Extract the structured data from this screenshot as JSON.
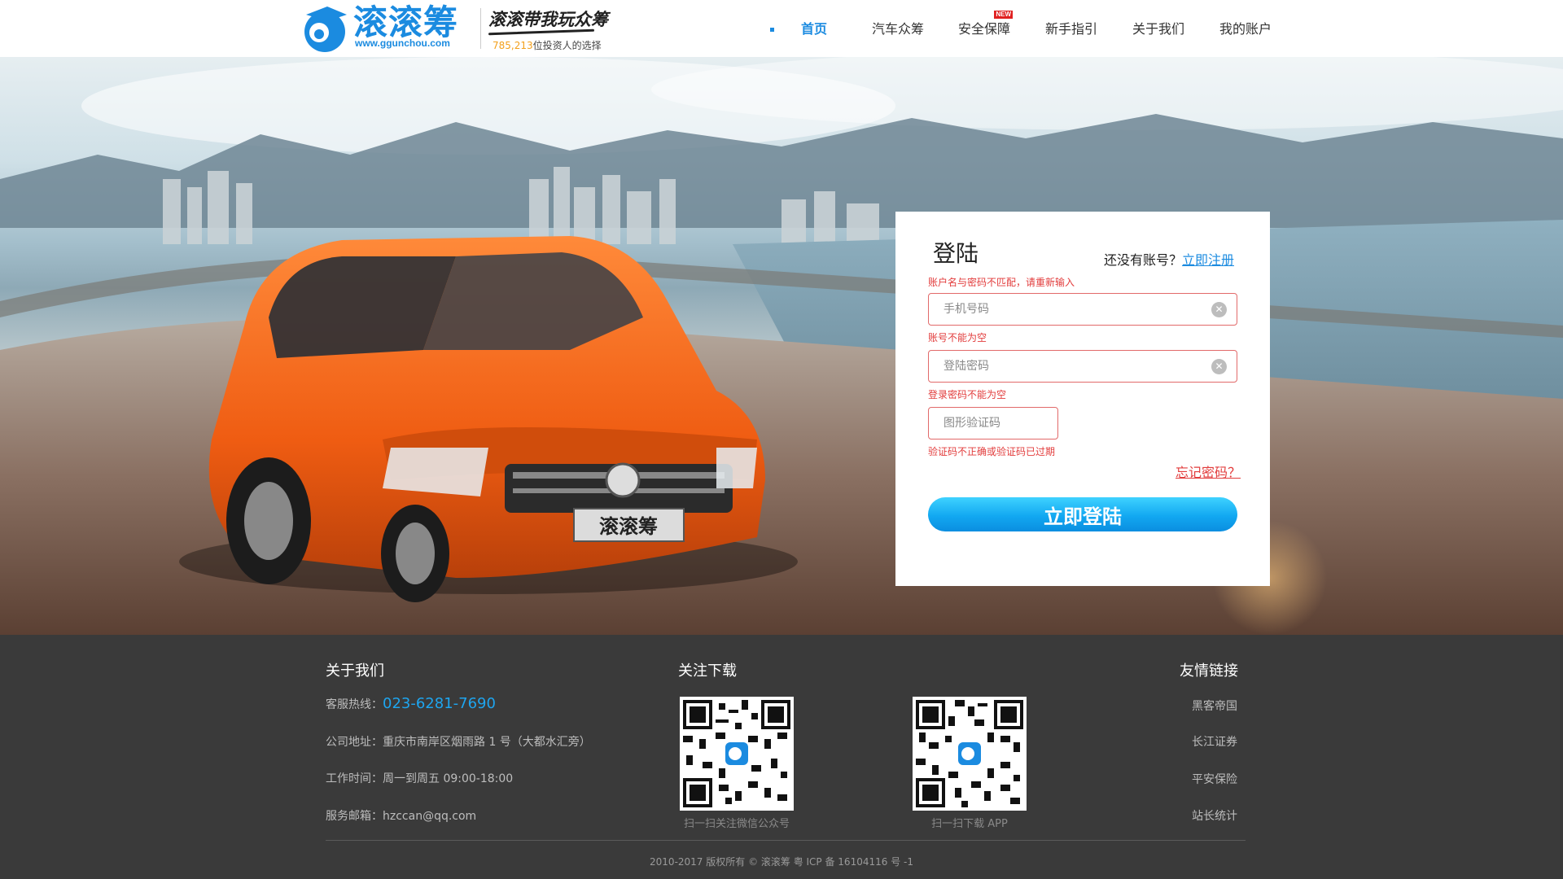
{
  "header": {
    "logo_text": "滚滚筹",
    "logo_url": "www.ggunchou.com",
    "slogan": "滚滚带我玩众筹",
    "tagline_count": "785,213",
    "tagline_rest": "位投资人的选择"
  },
  "nav": {
    "items": [
      {
        "label": "首页",
        "active": true
      },
      {
        "label": "汽车众筹"
      },
      {
        "label": "安全保障",
        "badge": "NEW"
      },
      {
        "label": "新手指引"
      },
      {
        "label": "关于我们"
      },
      {
        "label": "我的账户"
      }
    ]
  },
  "hero": {
    "plate_text": "滚滚筹"
  },
  "login": {
    "title": "登陆",
    "register_prompt": "还没有账号？",
    "register_link": "立即注册",
    "top_error": "账户名与密码不匹配，请重新输入",
    "phone_placeholder": "手机号码",
    "phone_error": "账号不能为空",
    "password_placeholder": "登陆密码",
    "password_error": "登录密码不能为空",
    "captcha_placeholder": "图形验证码",
    "captcha_error": "验证码不正确或验证码已过期",
    "forgot": "忘记密码？",
    "submit": "立即登陆"
  },
  "footer": {
    "about_title": "关于我们",
    "hotline_label": "客服热线：",
    "hotline": "023-6281-7690",
    "address": "公司地址：重庆市南岸区烟雨路 1 号（大都水汇旁）",
    "hours": "工作时间：周一到周五  09:00-18:00",
    "email": "服务邮箱：hzccan@qq.com",
    "follow_title": "关注下载",
    "qr1_caption": "扫一扫关注微信公众号",
    "qr2_caption": "扫一扫下载 APP",
    "links_title": "友情链接",
    "links": [
      "黑客帝国",
      "长江证券",
      "平安保险",
      "站长统计"
    ],
    "copyright": "2010-2017 版权所有 © 滚滚筹 粤 ICP 备 16104116 号 -1"
  },
  "colors": {
    "brand_blue": "#1b8be0",
    "error_red": "#e23c3c",
    "footer_bg": "#3a3a3a",
    "car_orange": "#f06a1e"
  }
}
